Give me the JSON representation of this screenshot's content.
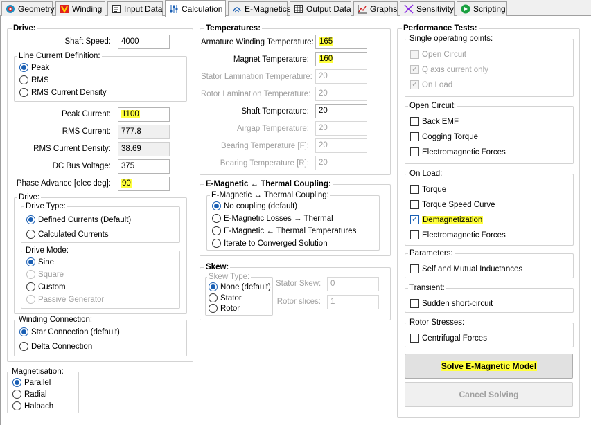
{
  "tabs": [
    {
      "label": "Geometry",
      "icon": "geometry-icon",
      "color": "#1a8fc4"
    },
    {
      "label": "Winding",
      "icon": "winding-icon",
      "color": "#e02020"
    },
    {
      "label": "Input Data",
      "icon": "input-data-icon",
      "color": "#333333"
    },
    {
      "label": "Calculation",
      "icon": "calculation-icon",
      "color": "#1a5fb4"
    },
    {
      "label": "E-Magnetics",
      "icon": "emagnetics-icon",
      "color": "#1a5fb4"
    },
    {
      "label": "Output Data",
      "icon": "output-data-icon",
      "color": "#333333"
    },
    {
      "label": "Graphs",
      "icon": "graphs-icon",
      "color": "#d02020"
    },
    {
      "label": "Sensitivity",
      "icon": "sensitivity-icon",
      "color": "#8a2be2"
    },
    {
      "label": "Scripting",
      "icon": "scripting-icon",
      "color": "#1aa040"
    }
  ],
  "drive": {
    "title": "Drive:",
    "shaft_speed_label": "Shaft Speed:",
    "shaft_speed": "4000",
    "line_current": {
      "title": "Line Current Definition:",
      "options": [
        "Peak",
        "RMS",
        "RMS Current Density"
      ],
      "selected": "Peak"
    },
    "peak_current_label": "Peak Current:",
    "peak_current": "1100",
    "rms_current_label": "RMS Current:",
    "rms_current": "777.8",
    "rms_density_label": "RMS Current Density:",
    "rms_density": "38.69",
    "dc_bus_label": "DC Bus Voltage:",
    "dc_bus": "375",
    "phase_advance_label": "Phase Advance [elec deg]:",
    "phase_advance": "90",
    "drive_sub": {
      "title": "Drive:",
      "type_title": "Drive Type:",
      "type_options": [
        "Defined Currents (Default)",
        "Calculated Currents"
      ],
      "mode_title": "Drive Mode:",
      "mode_options": [
        "Sine",
        "Square",
        "Custom",
        "Passive Generator"
      ]
    },
    "winding_conn": {
      "title": "Winding Connection:",
      "options": [
        "Star Connection (default)",
        "Delta Connection"
      ]
    }
  },
  "magnetisation": {
    "title": "Magnetisation:",
    "options": [
      "Parallel",
      "Radial",
      "Halbach"
    ]
  },
  "temperatures": {
    "title": "Temperatures:",
    "rows": [
      {
        "label": "Armature Winding Temperature:",
        "value": "165"
      },
      {
        "label": "Magnet Temperature:",
        "value": "160"
      },
      {
        "label": "Stator Lamination Temperature:",
        "value": "20"
      },
      {
        "label": "Rotor Lamination Temperature:",
        "value": "20"
      },
      {
        "label": "Shaft Temperature:",
        "value": "20"
      },
      {
        "label": "Airgap Temperature:",
        "value": "20"
      },
      {
        "label": "Bearing Temperature [F]:",
        "value": "20"
      },
      {
        "label": "Bearing Temperature [R]:",
        "value": "20"
      }
    ]
  },
  "coupling": {
    "title": "E-Magnetic ↔ Thermal Coupling:",
    "inner_title": "E-Magnetic ↔ Thermal Coupling:",
    "options": [
      "No coupling (default)",
      "E-Magnetic Losses → Thermal",
      "E-Magnetic ← Thermal Temperatures",
      "Iterate to Converged Solution"
    ]
  },
  "skew": {
    "title": "Skew:",
    "type_title": "Skew Type:",
    "options": [
      "None (default)",
      "Stator",
      "Rotor"
    ],
    "stator_skew_label": "Stator Skew:",
    "stator_skew": "0",
    "rotor_slices_label": "Rotor slices:",
    "rotor_slices": "1"
  },
  "perf": {
    "title": "Performance Tests:",
    "single_title": "Single operating points:",
    "single_options": [
      "Open Circuit",
      "Q axis current only",
      "On Load"
    ],
    "open_circuit_title": "Open Circuit:",
    "open_circuit_options": [
      "Back EMF",
      "Cogging Torque",
      "Electromagnetic Forces"
    ],
    "on_load_title": "On Load:",
    "on_load_options": [
      "Torque",
      "Torque Speed Curve",
      "Demagnetization",
      "Electromagnetic Forces"
    ],
    "parameters_title": "Parameters:",
    "parameters_option": "Self and Mutual Inductances",
    "transient_title": "Transient:",
    "transient_option": "Sudden short-circuit",
    "rotor_stresses_title": "Rotor Stresses:",
    "rotor_stresses_option": "Centrifugal Forces",
    "solve_label": "Solve E-Magnetic Model",
    "cancel_label": "Cancel Solving"
  },
  "colors": {
    "highlight": "#ffff3c",
    "accent": "#1a5fb4"
  }
}
